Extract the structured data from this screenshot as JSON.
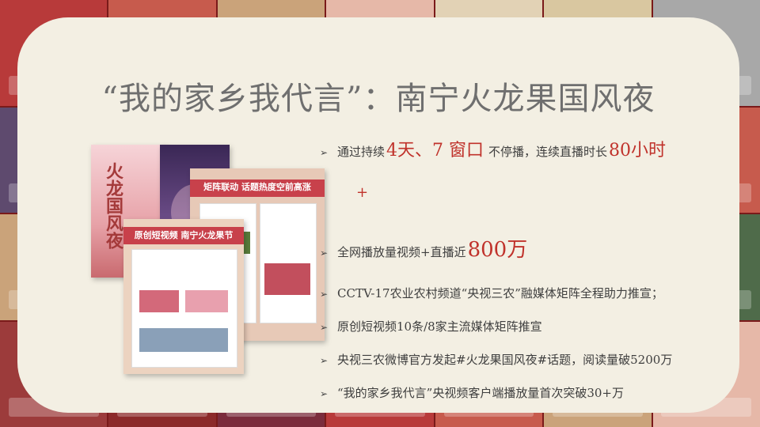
{
  "title": "“我的家乡我代言”：南宁火龙果国风夜",
  "bullets": [
    {
      "parts": [
        {
          "t": "通过持续",
          "c": ""
        },
        {
          "t": "4天、7 窗口",
          "c": "hl big"
        },
        {
          "t": "不停播，连续直播时长",
          "c": ""
        },
        {
          "t": "80小时",
          "c": "hl big"
        }
      ]
    },
    {
      "parts": [
        {
          "t": "全网播放量视频+直播近",
          "c": ""
        },
        {
          "t": "800万",
          "c": "hl huge"
        }
      ]
    },
    {
      "parts": [
        {
          "t": "CCTV-17农业农村频道“央视三农”融媒体矩阵全程助力推宣；",
          "c": ""
        }
      ]
    },
    {
      "parts": [
        {
          "t": "原创短视频10条/8家主流媒体矩阵推宣",
          "c": ""
        }
      ]
    },
    {
      "parts": [
        {
          "t": "央视三农微博官方发起#火龙果国风夜#话题，阅读量破5200万",
          "c": ""
        }
      ]
    },
    {
      "parts": [
        {
          "t": "“我的家乡我代言”央视频客户端播放量首次突破30+万",
          "c": ""
        }
      ]
    }
  ],
  "plus": "+",
  "arrow": "➢",
  "posters": {
    "poster1_text": "火龙国风夜",
    "poster3_text": "矩阵联动 话题热度空前高涨",
    "poster4_text": "原创短视频 南宁火龙果节"
  },
  "colors": {
    "accent": "#c0322b",
    "card": "#f3efe3",
    "text": "#3e3e3e",
    "title": "#6f6f6f"
  }
}
